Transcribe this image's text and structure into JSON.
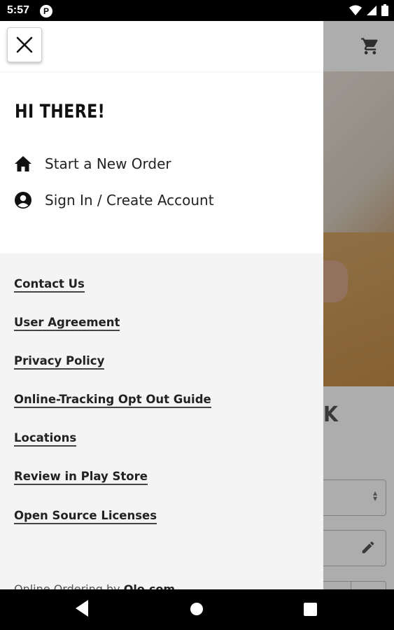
{
  "status_bar": {
    "time": "5:57",
    "app_icon_letter": "P"
  },
  "drawer": {
    "greeting": "HI THERE!",
    "nav_items": [
      {
        "label": "Start a New Order",
        "icon": "home-icon"
      },
      {
        "label": "Sign In / Create Account",
        "icon": "account-circle-icon"
      }
    ],
    "links": [
      "Contact Us",
      "User Agreement",
      "Privacy Policy",
      "Online-Tracking Opt Out Guide",
      "Locations",
      "Review in Play Store",
      "Open Source Licenses"
    ],
    "footer": {
      "prefix": "Online Ordering by",
      "brand": "Olo.com"
    }
  },
  "background": {
    "partial_heading_letter": "K"
  },
  "colors": {
    "drawer_bg": "#ffffff",
    "links_bg": "#f4f4f4",
    "text": "#222222",
    "scrim": "rgba(0,0,0,0.32)"
  }
}
